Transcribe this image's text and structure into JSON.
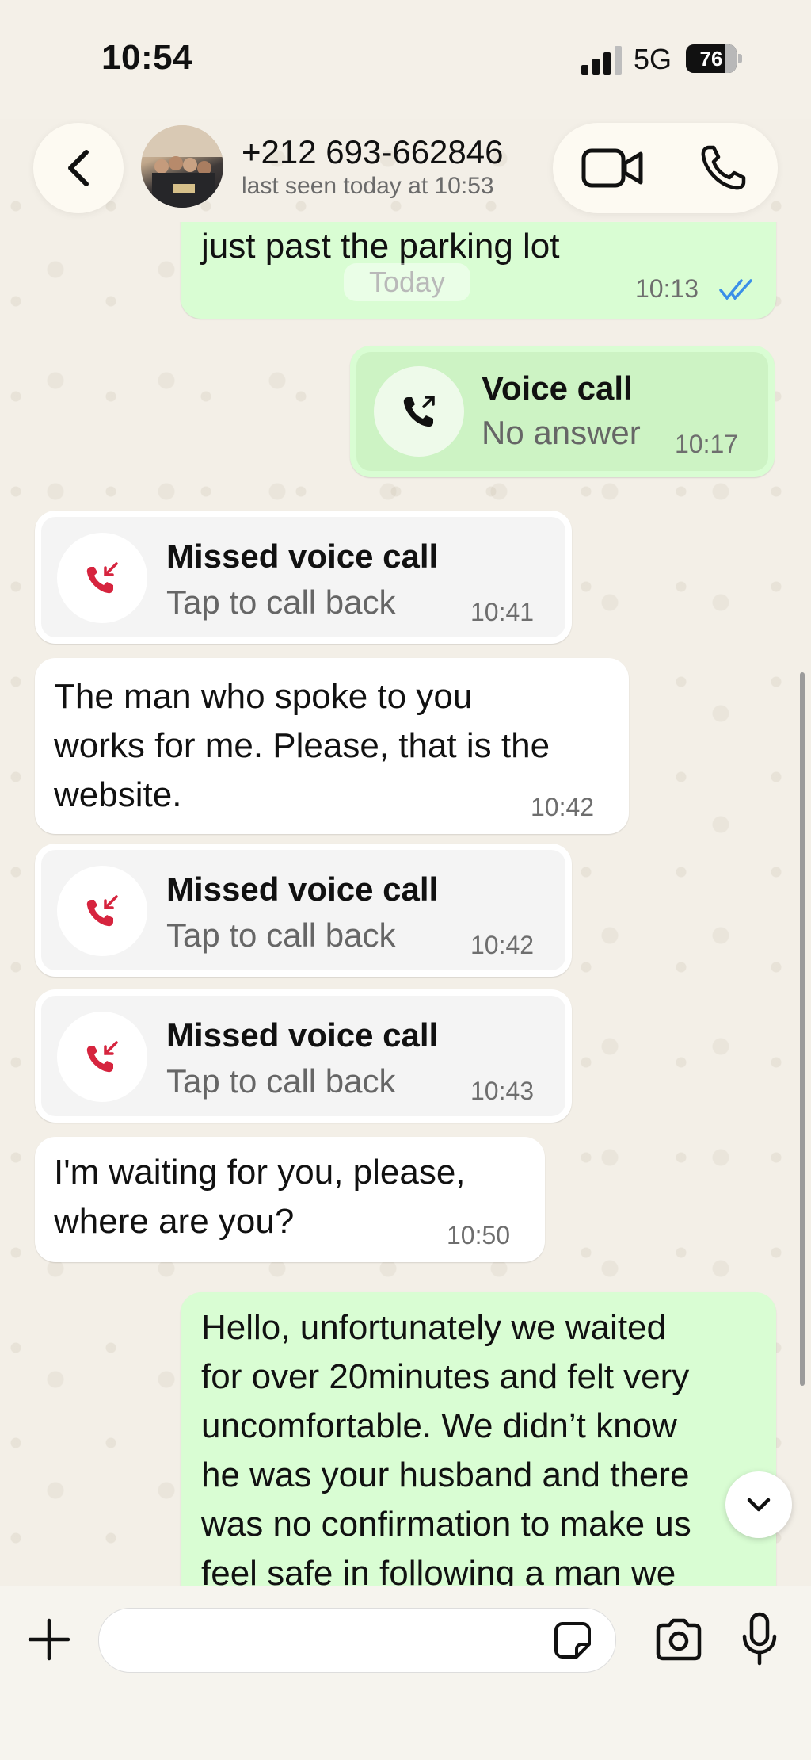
{
  "status_bar": {
    "time": "10:54",
    "network": "5G",
    "battery": "76",
    "battery_level": 0.76
  },
  "header": {
    "contact_name": "+212 693-662846",
    "last_seen": "last seen today at 10:53",
    "icons": [
      "back-chevron-icon",
      "video-camera-icon",
      "phone-icon"
    ]
  },
  "chat": {
    "date_chip": "Today",
    "messages": [
      {
        "type": "text",
        "direction": "outgoing",
        "text": "just past the parking lot",
        "time": "10:13",
        "status": "read"
      },
      {
        "type": "call",
        "direction": "outgoing",
        "title": "Voice call",
        "subtitle": "No answer",
        "time": "10:17"
      },
      {
        "type": "call",
        "direction": "incoming",
        "title": "Missed voice call",
        "subtitle": "Tap to call back",
        "time": "10:41"
      },
      {
        "type": "text",
        "direction": "incoming",
        "lines": [
          "The man who spoke to you",
          "works for me. Please, that is the",
          "website."
        ],
        "time": "10:42"
      },
      {
        "type": "call",
        "direction": "incoming",
        "title": "Missed voice call",
        "subtitle": "Tap to call back",
        "time": "10:42"
      },
      {
        "type": "call",
        "direction": "incoming",
        "title": "Missed voice call",
        "subtitle": "Tap to call back",
        "time": "10:43"
      },
      {
        "type": "text",
        "direction": "incoming",
        "lines": [
          "I'm waiting for you, please,",
          "where are you?"
        ],
        "time": "10:50"
      },
      {
        "type": "text",
        "direction": "outgoing",
        "lines": [
          "Hello, unfortunately we waited",
          "for over 20minutes and felt very",
          "uncomfortable. We didn’t know",
          "he was your husband and there",
          "was no confirmation to make us",
          "feel safe in following a man we"
        ]
      }
    ]
  },
  "input_bar": {
    "placeholder": "",
    "icons": [
      "plus-icon",
      "sticker-icon",
      "camera-icon",
      "microphone-icon"
    ]
  },
  "colors": {
    "outgoing_bubble": "#d9fdd3",
    "incoming_bubble": "#ffffff",
    "missed_call_red": "#d6243e",
    "read_ticks_blue": "#3a8fe8"
  }
}
